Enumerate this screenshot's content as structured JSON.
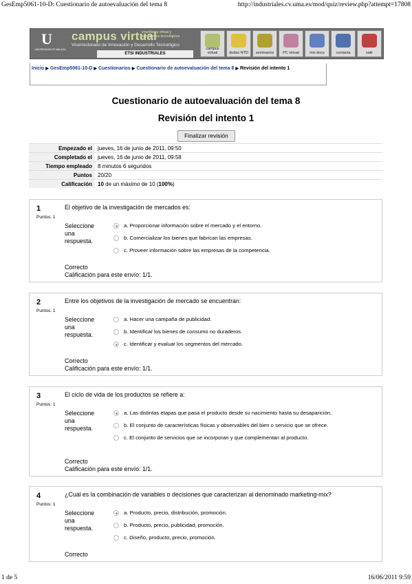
{
  "print_header": {
    "left": "GesEmp5061-10-D: Cuestionario de autoevaluación del tema 8",
    "right": "http://industriales.cv.uma.es/mod/quiz/review.php?attempt=17808"
  },
  "print_footer": {
    "left": "1 de 5",
    "right": "16/06/2011 9:59"
  },
  "banner": {
    "logo_letter": "U",
    "logo_sub": "UNIVERSIDAD DE MÁLAGA",
    "title": "campus virtual",
    "side_text": "enseñanza virtual y laboratorios tecnológicos",
    "subtitle": "Vicerrectorado de Innovación y Desarrollo Tecnológico",
    "school": "ETSI INDUSTRIALES",
    "icons": [
      {
        "label": "campus virtual",
        "color": "#b0c070"
      },
      {
        "label": "dudas NTD",
        "color": "#e0c040"
      },
      {
        "label": "seminarios",
        "color": "#b0a030"
      },
      {
        "label": "PC virtual",
        "color": "#c080a0"
      },
      {
        "label": "mis docs",
        "color": "#6080c0"
      },
      {
        "label": "contacta",
        "color": "#5070b0"
      },
      {
        "label": "salir",
        "color": "#c04040"
      }
    ]
  },
  "breadcrumb": {
    "items": [
      "Inicio",
      "GesEmp5061-10-D",
      "Cuestionarios",
      "Cuestionario de autoevaluación del tema 8"
    ],
    "current": "Revisión del intento 1"
  },
  "quiz_title": "Cuestionario de autoevaluación del tema 8",
  "attempt_title": "Revisión del intento 1",
  "finish_button": "Finalizar revisión",
  "summary": [
    {
      "label": "Empezado el",
      "value": "jueves, 16 de junio de 2011, 09:50"
    },
    {
      "label": "Completado el",
      "value": "jueves, 16 de junio de 2011, 09:58"
    },
    {
      "label": "Tiempo empleado",
      "value": "8 minutos 6 segundos"
    },
    {
      "label": "Puntos",
      "value": "20/20"
    },
    {
      "label": "Calificación",
      "value_bold": "10",
      "value_mid": " de un máximo de 10 (",
      "value_pct": "100%",
      "value_end": ")"
    }
  ],
  "questions": [
    {
      "number": "1",
      "points": "Puntos: 1",
      "text": "El objetivo de la investigación de mercados es:",
      "prompt": "Seleccione una respuesta.",
      "options": [
        {
          "text": "a. Proporcionar información sobre el mercado y el entorno.",
          "selected": true
        },
        {
          "text": "b. Comercializar los bienes que fabrican las empresas.",
          "selected": false
        },
        {
          "text": "c. Proveer información sobre las empresas de la competencia.",
          "selected": false
        }
      ],
      "result": "Correcto",
      "grade": "Calificación para este envío: 1/1."
    },
    {
      "number": "2",
      "points": "Puntos: 1",
      "text": "Entre los objetivos de la investigación de mercado se encuentran:",
      "prompt": "Seleccione una respuesta.",
      "options": [
        {
          "text": "a. Hacer una campaña de publicidad.",
          "selected": false
        },
        {
          "text": "b. Identificar los bienes de consumo no duraderos.",
          "selected": false
        },
        {
          "text": "c. Identificar y evaluar los segmentos del mercado.",
          "selected": true
        }
      ],
      "result": "Correcto",
      "grade": "Calificación para este envío: 1/1."
    },
    {
      "number": "3",
      "points": "Puntos: 1",
      "text": "El ciclo de vida de los productos se refiere a:",
      "prompt": "Seleccione una respuesta.",
      "options": [
        {
          "text": "a. Las distintas etapas que pasa el producto desde su nacimiento hasta su desaparición.",
          "selected": true
        },
        {
          "text": "b. El conjunto de características físicas y observables del bien o servicio que se ofrece.",
          "selected": false
        },
        {
          "text": "c. El conjunto de servicios que se incorporan y que complementan al producto.",
          "selected": false
        }
      ],
      "result": "Correcto",
      "grade": "Calificación para este envío: 1/1."
    },
    {
      "number": "4",
      "points": "Puntos: 1",
      "text": "¿Cuál es la combinación de variables o decisiones que caracterizan al denominado marketing-mix?",
      "prompt": "Seleccione una respuesta.",
      "options": [
        {
          "text": "a. Producto, precio, distribución, promoción.",
          "selected": true
        },
        {
          "text": "b. Producto, precio, publicidad, promoción.",
          "selected": false
        },
        {
          "text": "c. Diseño, producto, precio, promoción.",
          "selected": false
        }
      ],
      "result": "Correcto",
      "grade": ""
    }
  ]
}
